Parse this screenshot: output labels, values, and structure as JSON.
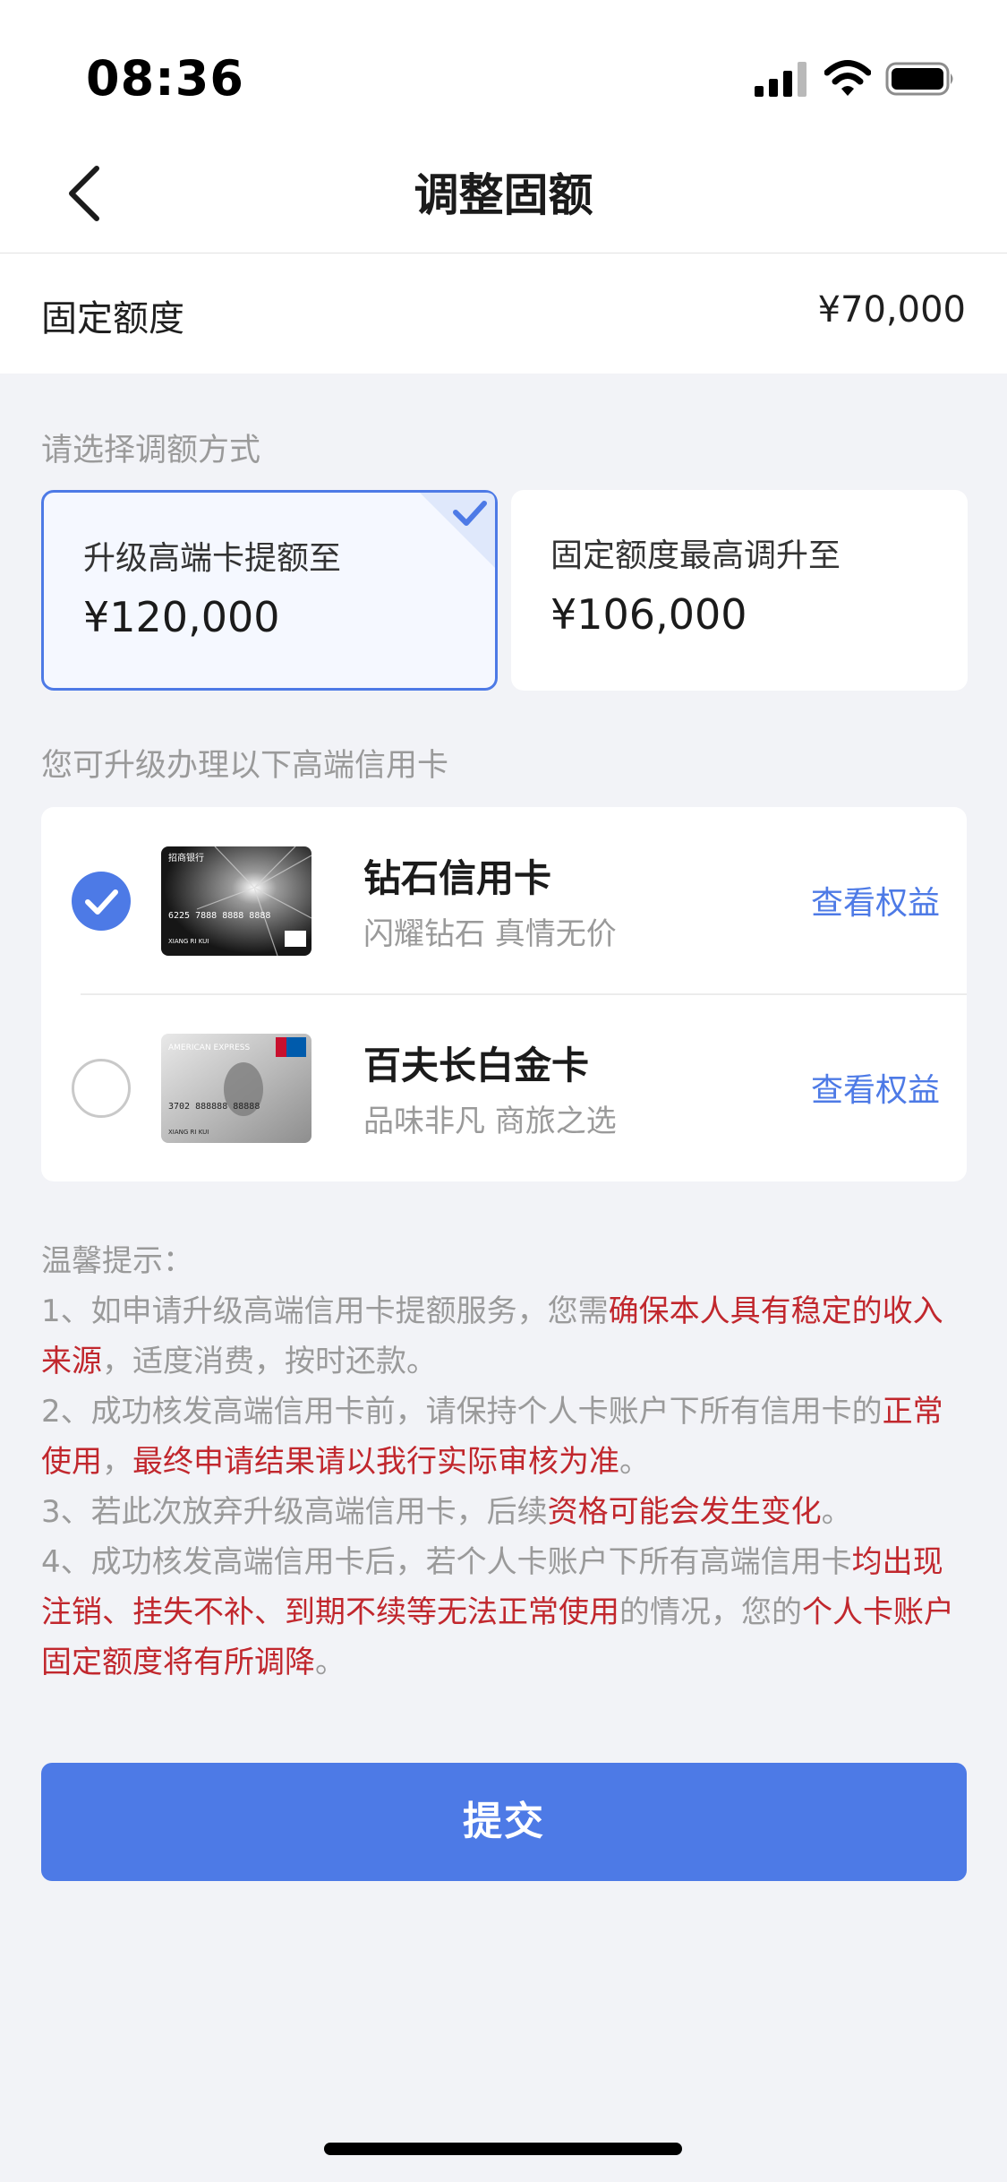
{
  "status_bar": {
    "time": "08:36"
  },
  "header": {
    "title": "调整固额"
  },
  "fixed_limit": {
    "label": "固定额度",
    "value": "¥70,000"
  },
  "sections": {
    "choose_method": "请选择调额方式",
    "upgrade_cards": "您可升级办理以下高端信用卡"
  },
  "options": [
    {
      "title": "升级高端卡提额至",
      "amount": "¥120,000",
      "selected": true
    },
    {
      "title": "固定额度最高调升至",
      "amount": "¥106,000",
      "selected": false
    }
  ],
  "cards": [
    {
      "name": "钻石信用卡",
      "slogan": "闪耀钻石 真情无价",
      "link": "查看权益",
      "selected": true,
      "face": {
        "bank": "招商银行",
        "number": "6225 7888 8888 8888",
        "holder": "XIANG RI KUI"
      }
    },
    {
      "name": "百夫长白金卡",
      "slogan": "品味非凡 商旅之选",
      "link": "查看权益",
      "selected": false,
      "face": {
        "brand": "AMERICAN EXPRESS",
        "number": "3702 888888 88888",
        "holder": "XIANG RI KUI"
      }
    }
  ],
  "tips": {
    "title": "温馨提示：",
    "item1_a": "1、如申请升级高端信用卡提额服务，您需",
    "item1_b": "确保本人具有稳定的收入来源",
    "item1_c": "，适度消费，按时还款。",
    "item2_a": "2、成功核发高端信用卡前，请保持个人卡账户下所有信用卡的",
    "item2_b": "正常使用",
    "item2_c": "，",
    "item2_d": "最终申请结果请以我行实际审核为准",
    "item2_e": "。",
    "item3_a": "3、若此次放弃升级高端信用卡，后续",
    "item3_b": "资格可能会发生变化",
    "item3_c": "。",
    "item4_a": "4、成功核发高端信用卡后，若个人卡账户下所有高端信用卡",
    "item4_b": "均出现注销、挂失不补、到期不续等无法正常使用",
    "item4_c": "的情况，您的",
    "item4_d": "个人卡账户固定额度将有所调降",
    "item4_e": "。"
  },
  "submit_label": "提交",
  "colors": {
    "accent": "#4d7ae6",
    "warning": "#c1272d",
    "background": "#f2f3f7"
  }
}
